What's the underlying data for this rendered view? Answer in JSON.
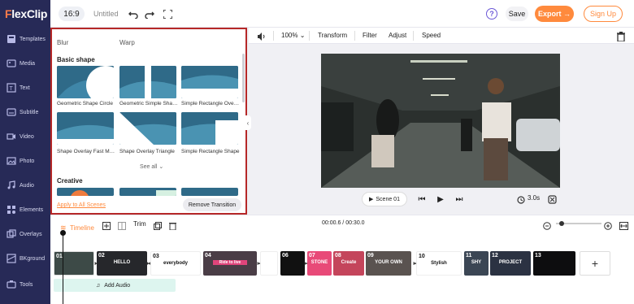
{
  "app": {
    "logo_prefix": "F",
    "logo_rest": "lexClip",
    "ratio": "16:9",
    "project_title": "Untitled",
    "save_label": "Save",
    "export_label": "Export →",
    "signup_label": "Sign Up",
    "help_label": "?"
  },
  "sidebar": {
    "items": [
      {
        "label": "Templates",
        "icon": "templates-icon"
      },
      {
        "label": "Media",
        "icon": "media-icon"
      },
      {
        "label": "Text",
        "icon": "text-icon"
      },
      {
        "label": "Subtitle",
        "icon": "subtitle-icon"
      },
      {
        "label": "Video",
        "icon": "video-icon"
      },
      {
        "label": "Photo",
        "icon": "photo-icon"
      },
      {
        "label": "Audio",
        "icon": "audio-icon"
      },
      {
        "label": "Elements",
        "icon": "elements-icon"
      },
      {
        "label": "Overlays",
        "icon": "overlays-icon"
      },
      {
        "label": "BKground",
        "icon": "background-icon"
      },
      {
        "label": "Tools",
        "icon": "tools-icon"
      }
    ]
  },
  "panel": {
    "tab_blur": "Blur",
    "tab_warp": "Warp",
    "section_basic": "Basic shape",
    "section_creative": "Creative",
    "thumbs": [
      "Geometric Shape Circle",
      "Geometric Simple Shape",
      "Simple Rectangle Overlay",
      "Shape Overlay Fast Move",
      "Shape Overlay Triangle",
      "Simple Rectangle Shape"
    ],
    "see_all": "See all",
    "apply_all": "Apply to All Scenes",
    "remove_transition": "Remove Transition"
  },
  "toolbar": {
    "zoom": "100%",
    "transform": "Transform",
    "filter": "Filter",
    "adjust": "Adjust",
    "speed": "Speed"
  },
  "player": {
    "scene": "Scene 01",
    "duration": "3.0s"
  },
  "timeline": {
    "label": "Timeline",
    "trim": "Trim",
    "time": "00:00.6 / 00:30.0",
    "add_audio": "Add Audio",
    "clips": [
      {
        "num": "01",
        "text": ""
      },
      {
        "num": "02",
        "text": "HELLO"
      },
      {
        "num": "03",
        "text": "everybody"
      },
      {
        "num": "04",
        "text": "Ride to live"
      },
      {
        "num": "06",
        "text": ""
      },
      {
        "num": "07",
        "text": "STONE"
      },
      {
        "num": "08",
        "text": "Create"
      },
      {
        "num": "09",
        "text": "YOUR OWN"
      },
      {
        "num": "10",
        "text": "Stylish"
      },
      {
        "num": "11",
        "text": "SHY"
      },
      {
        "num": "12",
        "text": "PROJECT"
      },
      {
        "num": "13",
        "text": ""
      }
    ]
  },
  "colors": {
    "sidebar": "#272a57",
    "accent": "#ff8a3d",
    "panel_border": "#b62828"
  }
}
